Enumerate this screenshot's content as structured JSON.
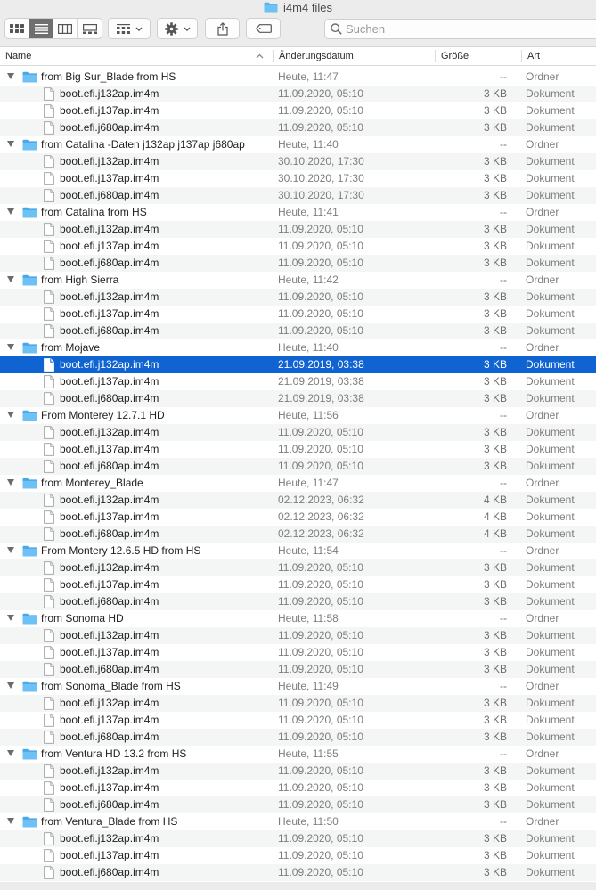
{
  "window": {
    "title": "i4m4 files"
  },
  "toolbar": {
    "view_icons": [
      "icon-view-icon",
      "list-view-icon",
      "column-view-icon",
      "gallery-view-icon"
    ],
    "group_icon": "group-grid-icon",
    "action_icon": "gear-icon",
    "share_icon": "share-icon",
    "tag_icon": "tag-icon"
  },
  "search": {
    "placeholder": "Suchen",
    "icon": "magnifier-icon"
  },
  "columns": {
    "name": "Name",
    "date": "Änderungsdatum",
    "size": "Größe",
    "kind": "Art"
  },
  "colors": {
    "selection": "#0f64d2",
    "folder": "#5ab4ef",
    "alt_row": "#f4f5f5"
  },
  "groups": [
    {
      "name": "from Big Sur_Blade from HS",
      "date": "Heute, 11:47",
      "size": "--",
      "kind": "Ordner",
      "files": [
        {
          "name": "boot.efi.j132ap.im4m",
          "date": "11.09.2020, 05:10",
          "size": "3 KB",
          "kind": "Dokument"
        },
        {
          "name": "boot.efi.j137ap.im4m",
          "date": "11.09.2020, 05:10",
          "size": "3 KB",
          "kind": "Dokument"
        },
        {
          "name": "boot.efi.j680ap.im4m",
          "date": "11.09.2020, 05:10",
          "size": "3 KB",
          "kind": "Dokument"
        }
      ]
    },
    {
      "name": "from Catalina -Daten j132ap j137ap j680ap",
      "date": "Heute, 11:40",
      "size": "--",
      "kind": "Ordner",
      "files": [
        {
          "name": "boot.efi.j132ap.im4m",
          "date": "30.10.2020, 17:30",
          "size": "3 KB",
          "kind": "Dokument"
        },
        {
          "name": "boot.efi.j137ap.im4m",
          "date": "30.10.2020, 17:30",
          "size": "3 KB",
          "kind": "Dokument"
        },
        {
          "name": "boot.efi.j680ap.im4m",
          "date": "30.10.2020, 17:30",
          "size": "3 KB",
          "kind": "Dokument"
        }
      ]
    },
    {
      "name": "from Catalina from HS",
      "date": "Heute, 11:41",
      "size": "--",
      "kind": "Ordner",
      "files": [
        {
          "name": "boot.efi.j132ap.im4m",
          "date": "11.09.2020, 05:10",
          "size": "3 KB",
          "kind": "Dokument"
        },
        {
          "name": "boot.efi.j137ap.im4m",
          "date": "11.09.2020, 05:10",
          "size": "3 KB",
          "kind": "Dokument"
        },
        {
          "name": "boot.efi.j680ap.im4m",
          "date": "11.09.2020, 05:10",
          "size": "3 KB",
          "kind": "Dokument"
        }
      ]
    },
    {
      "name": "from High Sierra",
      "date": "Heute, 11:42",
      "size": "--",
      "kind": "Ordner",
      "files": [
        {
          "name": "boot.efi.j132ap.im4m",
          "date": "11.09.2020, 05:10",
          "size": "3 KB",
          "kind": "Dokument"
        },
        {
          "name": "boot.efi.j137ap.im4m",
          "date": "11.09.2020, 05:10",
          "size": "3 KB",
          "kind": "Dokument"
        },
        {
          "name": "boot.efi.j680ap.im4m",
          "date": "11.09.2020, 05:10",
          "size": "3 KB",
          "kind": "Dokument"
        }
      ]
    },
    {
      "name": "from Mojave",
      "date": "Heute, 11:40",
      "size": "--",
      "kind": "Ordner",
      "files": [
        {
          "name": "boot.efi.j132ap.im4m",
          "date": "21.09.2019, 03:38",
          "size": "3 KB",
          "kind": "Dokument",
          "selected": true
        },
        {
          "name": "boot.efi.j137ap.im4m",
          "date": "21.09.2019, 03:38",
          "size": "3 KB",
          "kind": "Dokument"
        },
        {
          "name": "boot.efi.j680ap.im4m",
          "date": "21.09.2019, 03:38",
          "size": "3 KB",
          "kind": "Dokument"
        }
      ]
    },
    {
      "name": "From Monterey 12.7.1 HD",
      "date": "Heute, 11:56",
      "size": "--",
      "kind": "Ordner",
      "files": [
        {
          "name": "boot.efi.j132ap.im4m",
          "date": "11.09.2020, 05:10",
          "size": "3 KB",
          "kind": "Dokument"
        },
        {
          "name": "boot.efi.j137ap.im4m",
          "date": "11.09.2020, 05:10",
          "size": "3 KB",
          "kind": "Dokument"
        },
        {
          "name": "boot.efi.j680ap.im4m",
          "date": "11.09.2020, 05:10",
          "size": "3 KB",
          "kind": "Dokument"
        }
      ]
    },
    {
      "name": "from Monterey_Blade",
      "date": "Heute, 11:47",
      "size": "--",
      "kind": "Ordner",
      "files": [
        {
          "name": "boot.efi.j132ap.im4m",
          "date": "02.12.2023, 06:32",
          "size": "4 KB",
          "kind": "Dokument"
        },
        {
          "name": "boot.efi.j137ap.im4m",
          "date": "02.12.2023, 06:32",
          "size": "4 KB",
          "kind": "Dokument"
        },
        {
          "name": "boot.efi.j680ap.im4m",
          "date": "02.12.2023, 06:32",
          "size": "4 KB",
          "kind": "Dokument"
        }
      ]
    },
    {
      "name": "From Montery 12.6.5 HD from HS",
      "date": "Heute, 11:54",
      "size": "--",
      "kind": "Ordner",
      "files": [
        {
          "name": "boot.efi.j132ap.im4m",
          "date": "11.09.2020, 05:10",
          "size": "3 KB",
          "kind": "Dokument"
        },
        {
          "name": "boot.efi.j137ap.im4m",
          "date": "11.09.2020, 05:10",
          "size": "3 KB",
          "kind": "Dokument"
        },
        {
          "name": "boot.efi.j680ap.im4m",
          "date": "11.09.2020, 05:10",
          "size": "3 KB",
          "kind": "Dokument"
        }
      ]
    },
    {
      "name": "from Sonoma HD",
      "date": "Heute, 11:58",
      "size": "--",
      "kind": "Ordner",
      "files": [
        {
          "name": "boot.efi.j132ap.im4m",
          "date": "11.09.2020, 05:10",
          "size": "3 KB",
          "kind": "Dokument"
        },
        {
          "name": "boot.efi.j137ap.im4m",
          "date": "11.09.2020, 05:10",
          "size": "3 KB",
          "kind": "Dokument"
        },
        {
          "name": "boot.efi.j680ap.im4m",
          "date": "11.09.2020, 05:10",
          "size": "3 KB",
          "kind": "Dokument"
        }
      ]
    },
    {
      "name": "from Sonoma_Blade from HS",
      "date": "Heute, 11:49",
      "size": "--",
      "kind": "Ordner",
      "files": [
        {
          "name": "boot.efi.j132ap.im4m",
          "date": "11.09.2020, 05:10",
          "size": "3 KB",
          "kind": "Dokument"
        },
        {
          "name": "boot.efi.j137ap.im4m",
          "date": "11.09.2020, 05:10",
          "size": "3 KB",
          "kind": "Dokument"
        },
        {
          "name": "boot.efi.j680ap.im4m",
          "date": "11.09.2020, 05:10",
          "size": "3 KB",
          "kind": "Dokument"
        }
      ]
    },
    {
      "name": "from Ventura HD 13.2 from HS",
      "date": "Heute, 11:55",
      "size": "--",
      "kind": "Ordner",
      "files": [
        {
          "name": "boot.efi.j132ap.im4m",
          "date": "11.09.2020, 05:10",
          "size": "3 KB",
          "kind": "Dokument"
        },
        {
          "name": "boot.efi.j137ap.im4m",
          "date": "11.09.2020, 05:10",
          "size": "3 KB",
          "kind": "Dokument"
        },
        {
          "name": "boot.efi.j680ap.im4m",
          "date": "11.09.2020, 05:10",
          "size": "3 KB",
          "kind": "Dokument"
        }
      ]
    },
    {
      "name": "from Ventura_Blade from HS",
      "date": "Heute, 11:50",
      "size": "--",
      "kind": "Ordner",
      "files": [
        {
          "name": "boot.efi.j132ap.im4m",
          "date": "11.09.2020, 05:10",
          "size": "3 KB",
          "kind": "Dokument"
        },
        {
          "name": "boot.efi.j137ap.im4m",
          "date": "11.09.2020, 05:10",
          "size": "3 KB",
          "kind": "Dokument"
        },
        {
          "name": "boot.efi.j680ap.im4m",
          "date": "11.09.2020, 05:10",
          "size": "3 KB",
          "kind": "Dokument"
        }
      ]
    }
  ]
}
